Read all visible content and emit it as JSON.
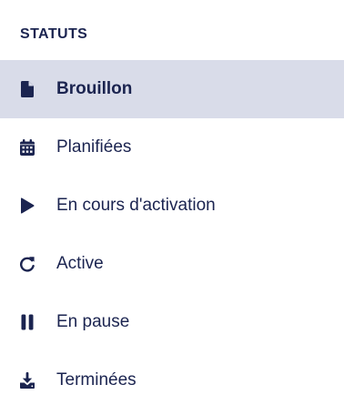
{
  "section": {
    "title": "STATUTS"
  },
  "items": [
    {
      "label": "Brouillon",
      "icon": "file-icon",
      "selected": true
    },
    {
      "label": "Planifiées",
      "icon": "calendar-icon",
      "selected": false
    },
    {
      "label": "En cours d'activation",
      "icon": "play-icon",
      "selected": false
    },
    {
      "label": "Active",
      "icon": "refresh-icon",
      "selected": false
    },
    {
      "label": "En pause",
      "icon": "pause-icon",
      "selected": false
    },
    {
      "label": "Terminées",
      "icon": "download-icon",
      "selected": false
    }
  ],
  "colors": {
    "text": "#1b2450",
    "selected_bg": "#d9dce9",
    "background": "#ffffff"
  }
}
